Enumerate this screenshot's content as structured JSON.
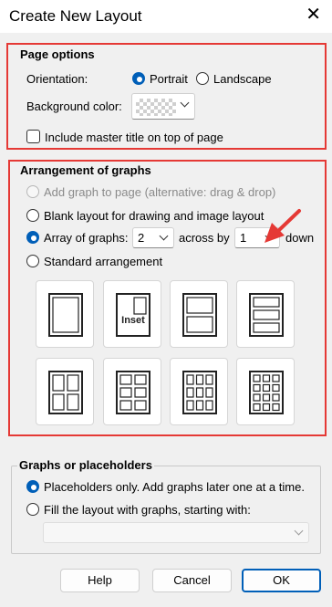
{
  "dialog": {
    "title": "Create New Layout",
    "close_glyph": "✕"
  },
  "page_options": {
    "title": "Page options",
    "orientation_label": "Orientation:",
    "portrait_label": "Portrait",
    "landscape_label": "Landscape",
    "orientation_selected": "Portrait",
    "background_label": "Background color:",
    "background_value": "transparent",
    "include_master_title_label": "Include master title on top of page",
    "include_master_title_checked": false
  },
  "arrangement": {
    "title": "Arrangement of graphs",
    "option_add_graph": "Add graph to page (alternative: drag & drop)",
    "option_blank_layout": "Blank layout for drawing and image layout",
    "option_array": "Array of graphs:",
    "array_across_value": "2",
    "across_by_label": "across by",
    "array_down_value": "1",
    "down_label": "down",
    "option_standard": "Standard arrangement",
    "selected": "array",
    "inset_label": "Inset",
    "layouts": [
      "single",
      "inset",
      "two-stacked",
      "three-stacked",
      "two-by-two",
      "two-by-three",
      "three-by-three",
      "three-by-four"
    ]
  },
  "graphs_placeholders": {
    "title": "Graphs or placeholders",
    "option_placeholders": "Placeholders only. Add graphs later one at a time.",
    "option_fill": "Fill the layout with graphs, starting with:",
    "selected": "placeholders",
    "fill_value": ""
  },
  "buttons": {
    "help": "Help",
    "cancel": "Cancel",
    "ok": "OK"
  },
  "colors": {
    "highlight": "#e53935",
    "accent": "#005fb8",
    "annotation_arrow": "#e53935"
  }
}
